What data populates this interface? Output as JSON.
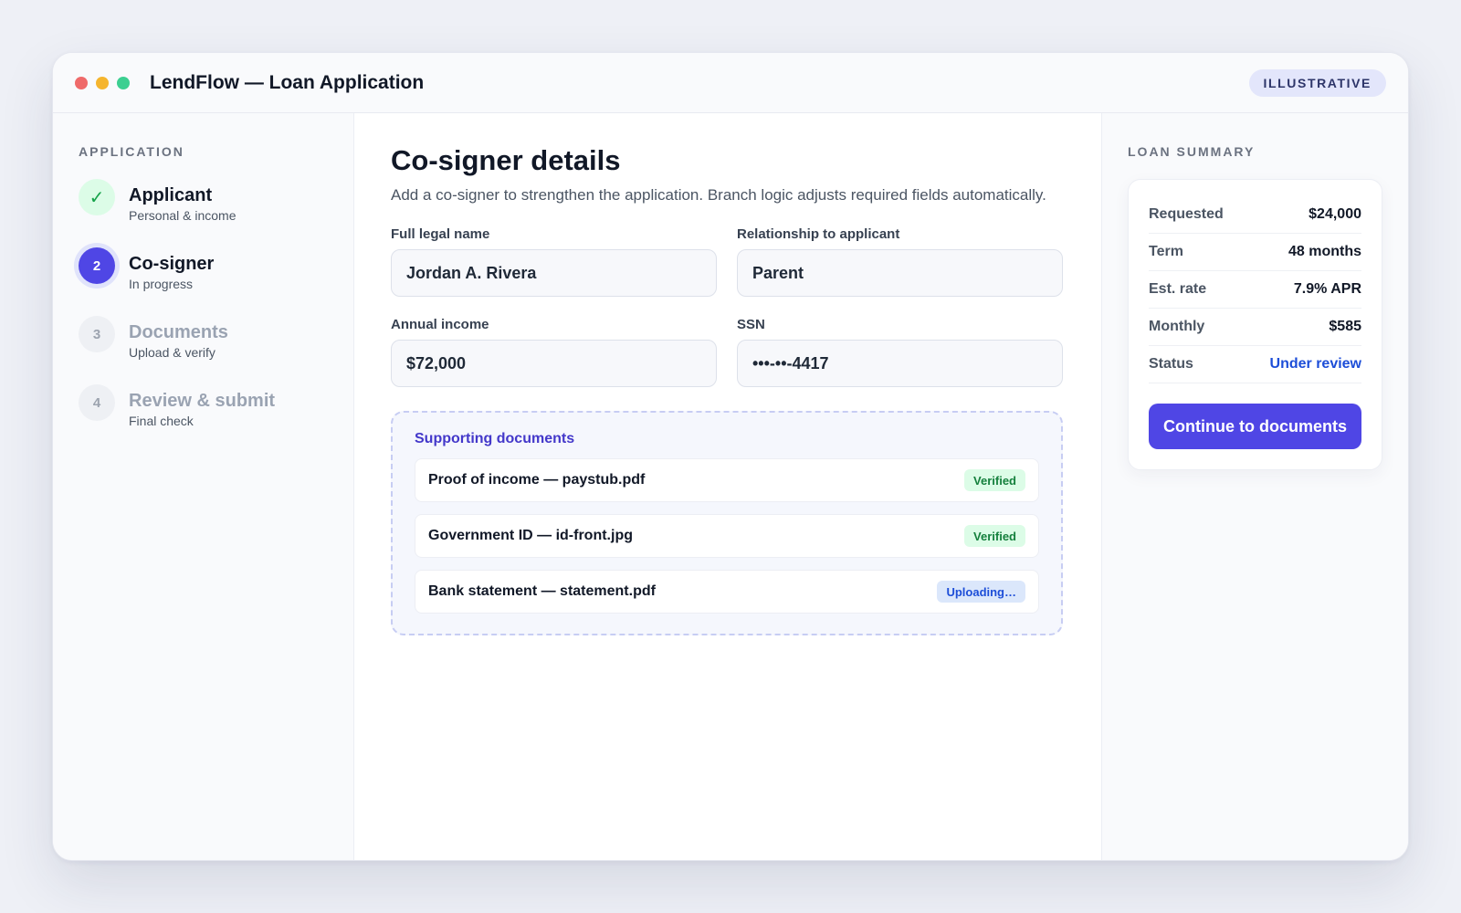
{
  "window": {
    "title": "LendFlow — Loan Application",
    "tag": "ILLUSTRATIVE",
    "traffic_lights": [
      "#ef6a6a",
      "#f5b52e",
      "#3ccf91"
    ]
  },
  "sidebar": {
    "section_label": "APPLICATION",
    "steps": [
      {
        "marker": "✓",
        "title": "Applicant",
        "subtitle": "Personal & income",
        "state": "done"
      },
      {
        "marker": "2",
        "title": "Co-signer",
        "subtitle": "In progress",
        "state": "active"
      },
      {
        "marker": "3",
        "title": "Documents",
        "subtitle": "Upload & verify",
        "state": "todo"
      },
      {
        "marker": "4",
        "title": "Review & submit",
        "subtitle": "Final check",
        "state": "todo"
      }
    ]
  },
  "main": {
    "heading": "Co-signer details",
    "subtitle": "Add a co-signer to strengthen the application. Branch logic adjusts required fields automatically.",
    "fields": [
      {
        "label": "Full legal name",
        "value": "Jordan A. Rivera"
      },
      {
        "label": "Relationship to applicant",
        "value": "Parent"
      },
      {
        "label": "Annual income",
        "value": "$72,000"
      },
      {
        "label": "SSN",
        "value": "•••-••-4417"
      }
    ],
    "documents": {
      "title": "Supporting documents",
      "items": [
        {
          "name": "Proof of income — paystub.pdf",
          "status": "Verified",
          "state": "ok"
        },
        {
          "name": "Government ID — id-front.jpg",
          "status": "Verified",
          "state": "ok"
        },
        {
          "name": "Bank statement — statement.pdf",
          "status": "Uploading…",
          "state": "prog"
        }
      ]
    }
  },
  "summary": {
    "section_label": "LOAN SUMMARY",
    "rows": [
      {
        "key": "Requested",
        "value": "$24,000"
      },
      {
        "key": "Term",
        "value": "48 months"
      },
      {
        "key": "Est. rate",
        "value": "7.9% APR"
      },
      {
        "key": "Monthly",
        "value": "$585"
      },
      {
        "key": "Status",
        "value": "Under review"
      }
    ],
    "cta_label": "Continue to documents",
    "accent": "#4f46e5"
  }
}
